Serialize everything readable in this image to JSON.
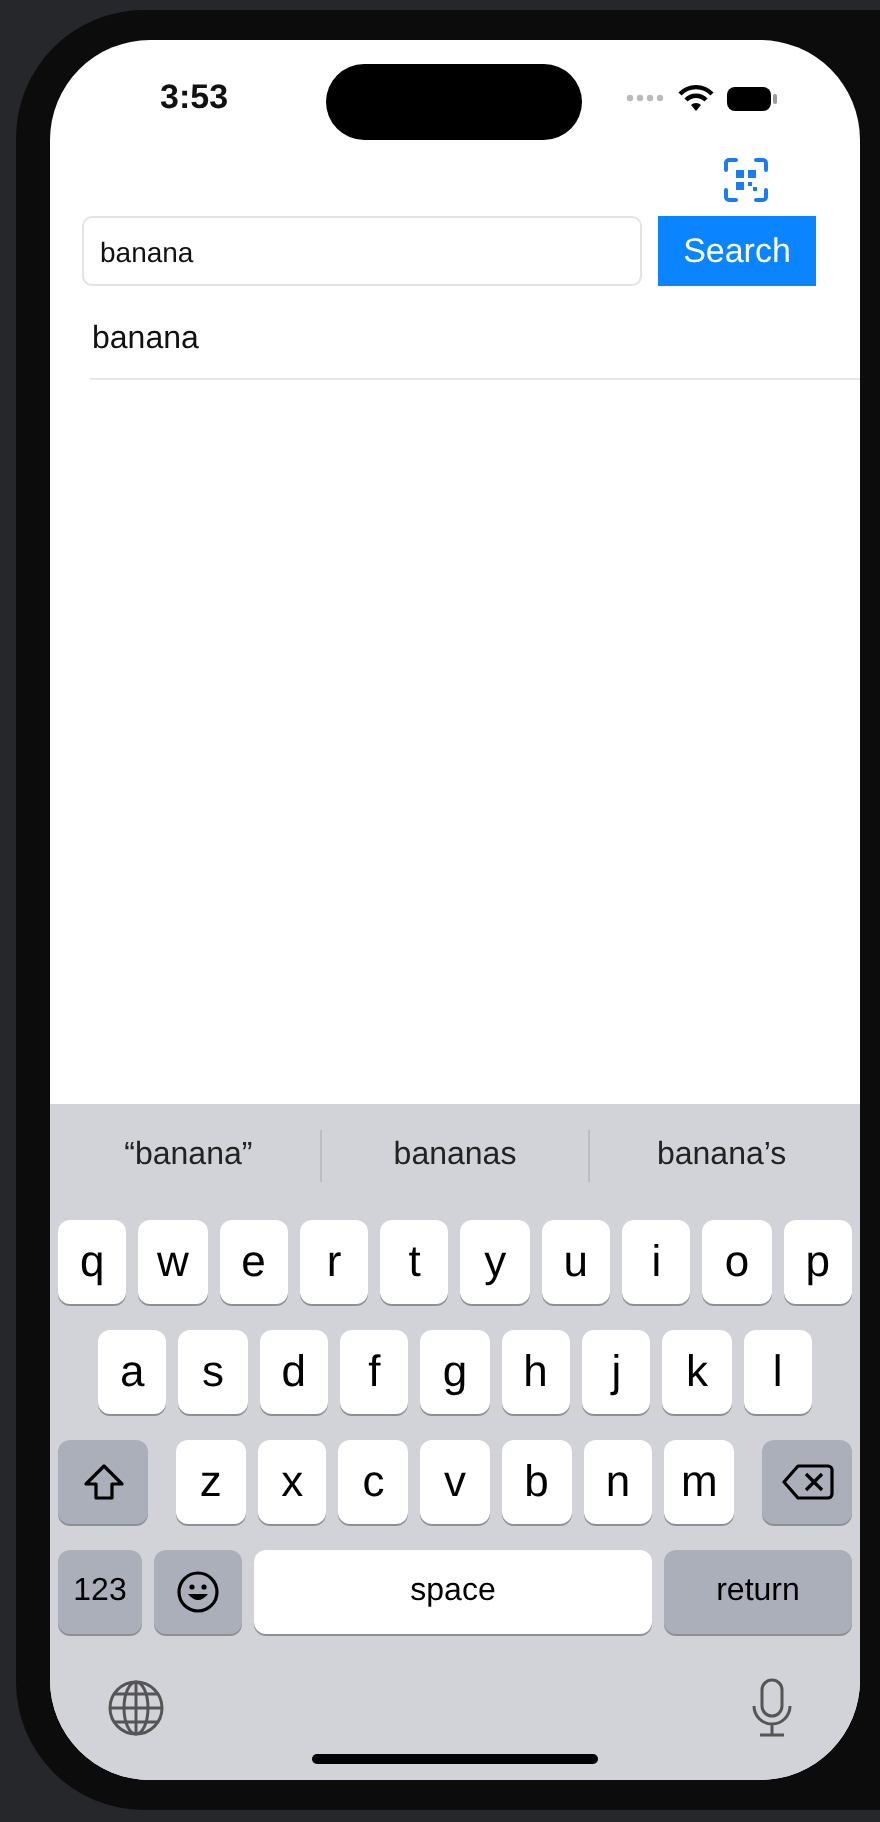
{
  "status_bar": {
    "time": "3:53"
  },
  "search": {
    "value": "banana",
    "button": "Search"
  },
  "results": [
    {
      "text": "banana"
    }
  ],
  "keyboard": {
    "suggestions": [
      "“banana”",
      "bananas",
      "banana’s"
    ],
    "rows": [
      {
        "keys": [
          {
            "kind": "letter",
            "label": "q"
          },
          {
            "kind": "letter",
            "label": "w"
          },
          {
            "kind": "letter",
            "label": "e"
          },
          {
            "kind": "letter",
            "label": "r"
          },
          {
            "kind": "letter",
            "label": "t"
          },
          {
            "kind": "letter",
            "label": "y"
          },
          {
            "kind": "letter",
            "label": "u"
          },
          {
            "kind": "letter",
            "label": "i"
          },
          {
            "kind": "letter",
            "label": "o"
          },
          {
            "kind": "letter",
            "label": "p"
          }
        ]
      },
      {
        "keys": [
          {
            "kind": "letter",
            "label": "a"
          },
          {
            "kind": "letter",
            "label": "s"
          },
          {
            "kind": "letter",
            "label": "d"
          },
          {
            "kind": "letter",
            "label": "f"
          },
          {
            "kind": "letter",
            "label": "g"
          },
          {
            "kind": "letter",
            "label": "h"
          },
          {
            "kind": "letter",
            "label": "j"
          },
          {
            "kind": "letter",
            "label": "k"
          },
          {
            "kind": "letter",
            "label": "l"
          }
        ]
      },
      {
        "keys": [
          {
            "kind": "shift"
          },
          {
            "kind": "letter",
            "label": "z"
          },
          {
            "kind": "letter",
            "label": "x"
          },
          {
            "kind": "letter",
            "label": "c"
          },
          {
            "kind": "letter",
            "label": "v"
          },
          {
            "kind": "letter",
            "label": "b"
          },
          {
            "kind": "letter",
            "label": "n"
          },
          {
            "kind": "letter",
            "label": "m"
          },
          {
            "kind": "delete"
          }
        ]
      },
      {
        "keys": [
          {
            "kind": "mode",
            "label": "123"
          },
          {
            "kind": "emoji"
          },
          {
            "kind": "space",
            "label": "space"
          },
          {
            "kind": "return",
            "label": "return"
          }
        ]
      }
    ]
  }
}
